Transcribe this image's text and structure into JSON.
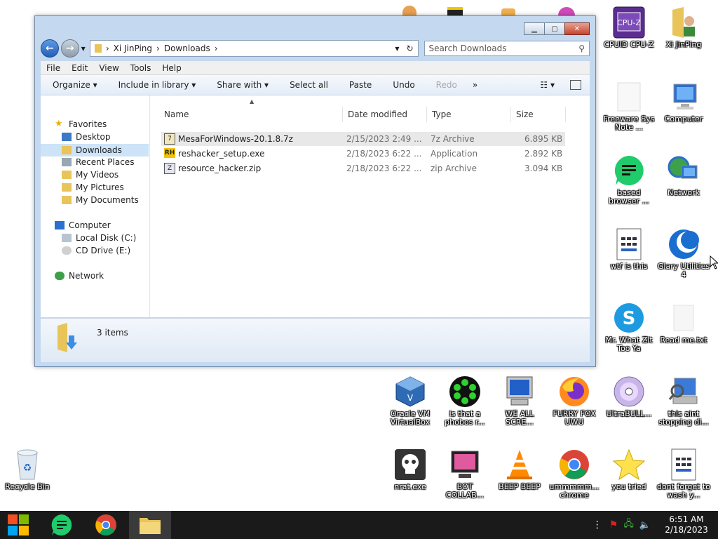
{
  "window": {
    "address": [
      "Xi JinPing",
      "Downloads"
    ],
    "search_placeholder": "Search Downloads",
    "menu": [
      "File",
      "Edit",
      "View",
      "Tools",
      "Help"
    ],
    "commands": [
      "Organize",
      "Include in library",
      "Share with",
      "Select all",
      "Paste",
      "Undo",
      "Redo",
      "»"
    ],
    "nav": {
      "favorites": "Favorites",
      "favorites_items": [
        "Desktop",
        "Downloads",
        "Recent Places",
        "My Videos",
        "My Pictures",
        "My Documents"
      ],
      "computer": "Computer",
      "computer_items": [
        "Local Disk (C:)",
        "CD Drive (E:)"
      ],
      "network": "Network"
    },
    "columns": [
      "Name",
      "Date modified",
      "Type",
      "Size"
    ],
    "files": [
      {
        "name": "MesaForWindows-20.1.8.7z",
        "date": "2/15/2023 2:49 ...",
        "type": "7z Archive",
        "size": "6.895 KB"
      },
      {
        "name": "reshacker_setup.exe",
        "date": "2/18/2023 6:22 ...",
        "type": "Application",
        "size": "2.892 KB"
      },
      {
        "name": "resource_hacker.zip",
        "date": "2/18/2023 6:22 ...",
        "type": "zip Archive",
        "size": "3.094 KB"
      }
    ],
    "status": "3 items"
  },
  "desktop": {
    "cpuz": "CPUID CPU-Z",
    "xijinping": "Xi JinPing",
    "freeware": "Freeware Sys Note ...",
    "computer": "Computer",
    "based_browser": "based browser ...",
    "network": "Network",
    "wtf": "wtf is this",
    "glary": "Glary Utilities 4",
    "skype": "Mr. What Zit Too Ya",
    "readme": "Read me.txt",
    "virtualbox": "Oracle VM VirtualBox",
    "icq": "is that a phobos r...",
    "weallscre": "WE ALL SCRE...",
    "furry": "FURRY FOX UWU",
    "ultrabull": "UltraBULL...",
    "thisaint": "this aint stopping di...",
    "recycle": "Recycle Bin",
    "nrat": "nrat.exe",
    "botcollab": "BOT COLLAB...",
    "beep": "BEEP BEEP",
    "chrome": "ummmmm... chrome",
    "youtried": "you tried",
    "dontforget": "dont forget to wash y..."
  },
  "taskbar": {
    "time": "6:51 AM",
    "date": "2/18/2023"
  },
  "colors": {
    "titlebar": "#c4d9ef",
    "selection": "#cde3f8",
    "taskbar": "#1a1a1a"
  }
}
